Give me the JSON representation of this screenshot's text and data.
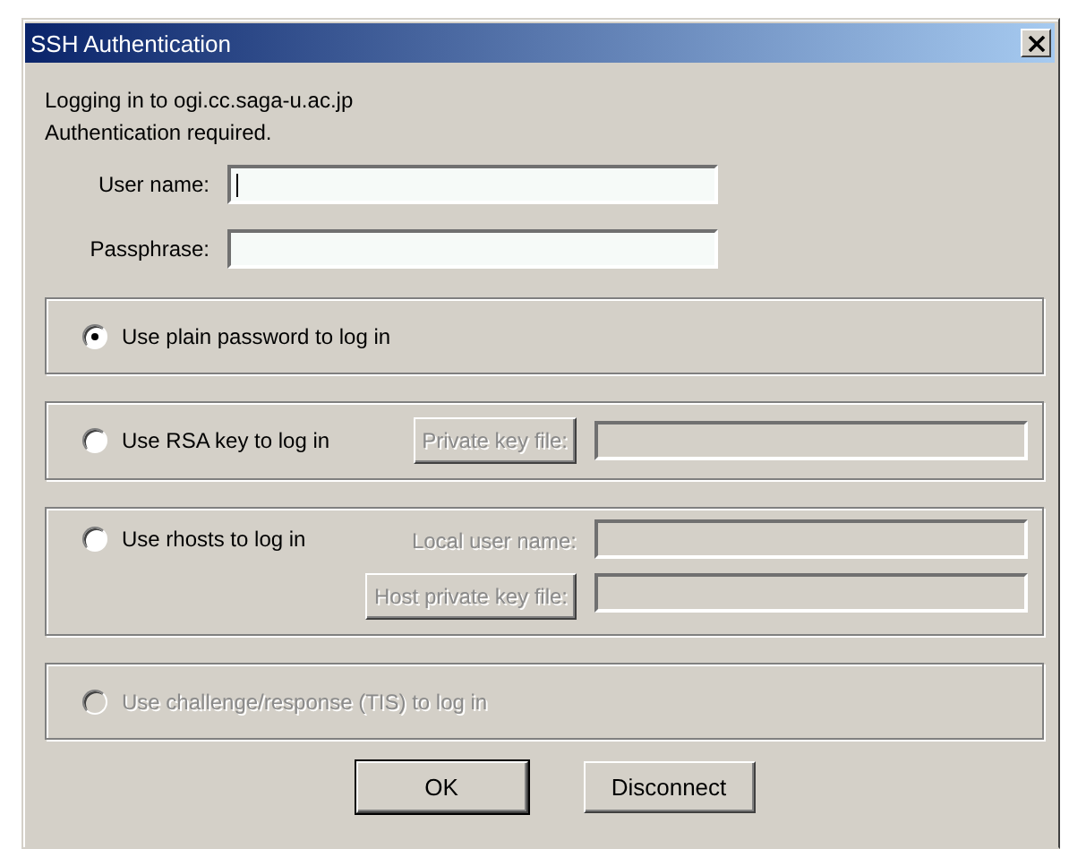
{
  "window": {
    "title": "SSH Authentication"
  },
  "messages": [
    "Logging in to ogi.cc.saga-u.ac.jp",
    "Authentication required."
  ],
  "fields": [
    {
      "label": "User name:",
      "focused": true
    },
    {
      "label": "Passphrase:",
      "focused": false
    }
  ],
  "methods": [
    {
      "label": "Use plain password to log in",
      "selected": true,
      "disabled": false
    },
    {
      "label": "Use RSA key to log in",
      "selected": false,
      "disabled": false,
      "rows": [
        {
          "kind": "button",
          "label": "Private key file:"
        }
      ]
    },
    {
      "label": "Use rhosts to log in",
      "selected": false,
      "disabled": false,
      "rows": [
        {
          "kind": "label",
          "label": "Local user name:"
        },
        {
          "kind": "button",
          "label": "Host private key file:"
        }
      ]
    },
    {
      "label": "Use challenge/response (TIS) to log in",
      "selected": false,
      "disabled": true
    }
  ],
  "buttons": [
    {
      "label": "OK",
      "default": true
    },
    {
      "label": "Disconnect",
      "default": false
    }
  ]
}
